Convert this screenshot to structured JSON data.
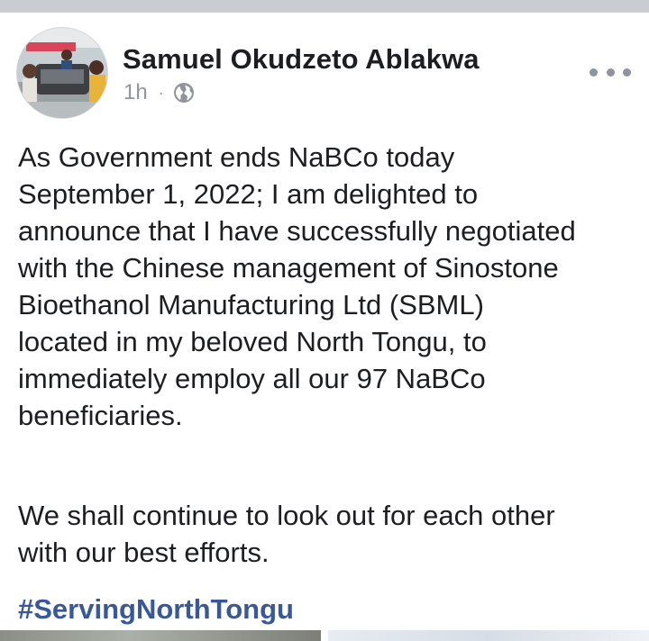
{
  "post": {
    "author": "Samuel Okudzeto Ablakwa",
    "time": "1h",
    "separator": "·",
    "privacy_icon": "globe-icon",
    "paragraph1": "As Government ends NaBCo today\nSeptember 1, 2022; I am delighted to\nannounce that I have successfully negotiated\nwith the Chinese management of Sinostone\nBioethanol Manufacturing Ltd (SBML)\nlocated in my beloved North Tongu, to\nimmediately employ all our 97 NaBCo\nbeneficiaries.",
    "paragraph2": "We shall continue to look out for each other\nwith our best efforts.",
    "hashtag": "#ServingNorthTongu"
  },
  "colors": {
    "author": "#1c1e21",
    "meta": "#90949c",
    "hashtag": "#385898",
    "top_bar": "#c9ccd1"
  }
}
